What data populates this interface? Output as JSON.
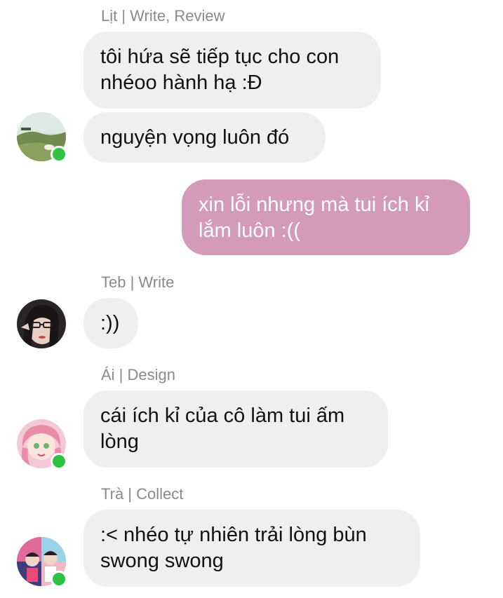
{
  "colors": {
    "incoming_bubble": "#efefef",
    "outgoing_bubble": "#d39ab9",
    "online_dot": "#2fc344",
    "sender_name": "#8a8a8a"
  },
  "messages": [
    {
      "sender": "Lịt | Write, Review",
      "bubbles": [
        "tôi hứa sẽ tiếp tục cho con\nnhéoo hành hạ :Đ",
        "nguyện vọng luôn đó"
      ],
      "online": true
    },
    {
      "sender": "",
      "outgoing": true,
      "bubbles": [
        "xin lỗi nhưng mà tui ích kỉ\nlắm luôn :(("
      ]
    },
    {
      "sender": "Teb | Write",
      "bubbles": [
        ":))"
      ],
      "online": false
    },
    {
      "sender": "Ái | Design",
      "bubbles": [
        "cái ích kỉ của cô làm tui ấm\nlòng"
      ],
      "online": true
    },
    {
      "sender": "Trà | Collect",
      "bubbles": [
        ":< nhéo tự nhiên trải lòng bùn\nswong swong"
      ],
      "online": true
    }
  ]
}
